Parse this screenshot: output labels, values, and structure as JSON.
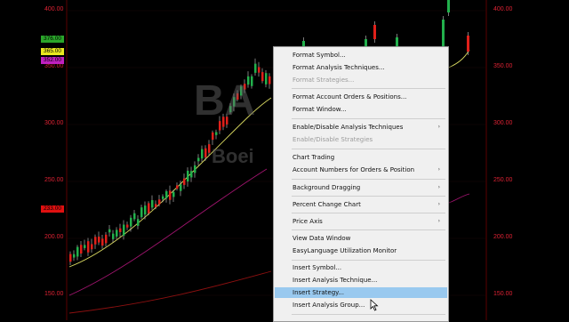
{
  "chart": {
    "watermark_symbol": "BA",
    "watermark_name": "Boei",
    "left_axis_labels": [
      "400.00",
      "350.00",
      "300.00",
      "250.00",
      "200.00",
      "150.00"
    ],
    "right_axis_labels": [
      "400.00",
      "350.00",
      "300.00",
      "250.00",
      "200.00",
      "150.00"
    ],
    "badges": [
      {
        "text": "376.00",
        "color": "#2aa52a"
      },
      {
        "text": "365.00",
        "color": "#e8e820"
      },
      {
        "text": "352.00",
        "color": "#c020c0"
      },
      {
        "text": "233.00",
        "color": "#e01010"
      }
    ],
    "colors": {
      "up": "#22b14c",
      "down": "#e0201a",
      "ma_fast": "#d8d860",
      "ma_mid": "#a0146e",
      "ma_slow": "#8c1010",
      "axis_text": "#d23333"
    }
  },
  "context_menu": {
    "items": [
      {
        "label": "Format Symbol...",
        "enabled": true,
        "submenu": false
      },
      {
        "label": "Format Analysis Techniques...",
        "enabled": true,
        "submenu": false
      },
      {
        "label": "Format Strategies...",
        "enabled": false,
        "submenu": false
      },
      {
        "label": "Format Account Orders & Positions...",
        "enabled": true,
        "submenu": false
      },
      {
        "label": "Format Window...",
        "enabled": true,
        "submenu": false
      },
      {
        "label": "Enable/Disable Analysis Techniques",
        "enabled": true,
        "submenu": true
      },
      {
        "label": "Enable/Disable Strategies",
        "enabled": false,
        "submenu": false
      },
      {
        "label": "Chart Trading",
        "enabled": true,
        "submenu": false
      },
      {
        "label": "Account Numbers for Orders & Position",
        "enabled": true,
        "submenu": true
      },
      {
        "label": "Background Dragging",
        "enabled": true,
        "submenu": true
      },
      {
        "label": "Percent Change Chart",
        "enabled": true,
        "submenu": true
      },
      {
        "label": "Price Axis",
        "enabled": true,
        "submenu": true
      },
      {
        "label": "View Data Window",
        "enabled": true,
        "submenu": false
      },
      {
        "label": "EasyLanguage Utilization Monitor",
        "enabled": true,
        "submenu": false
      },
      {
        "label": "Insert Symbol...",
        "enabled": true,
        "submenu": false
      },
      {
        "label": "Insert Analysis Technique...",
        "enabled": true,
        "submenu": false
      },
      {
        "label": "Insert Strategy...",
        "enabled": true,
        "submenu": false,
        "highlighted": true
      },
      {
        "label": "Insert Analysis Group...",
        "enabled": true,
        "submenu": false
      }
    ],
    "submenu_arrow": "›"
  }
}
